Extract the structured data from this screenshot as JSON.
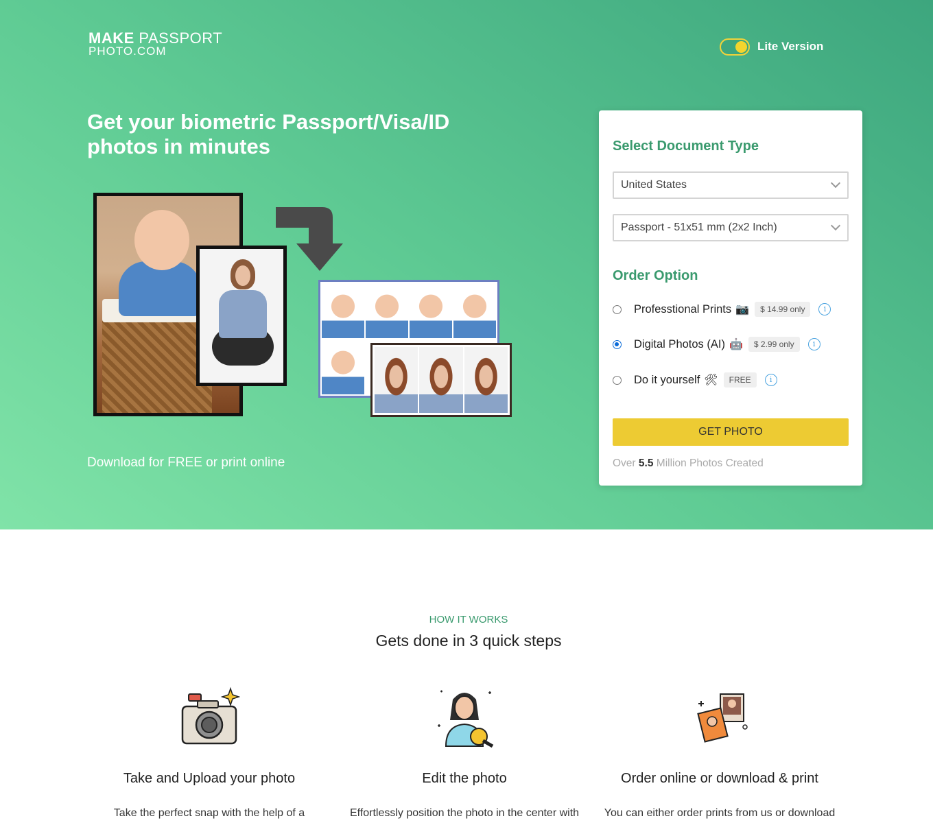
{
  "header": {
    "logo_line1_bold": "MAKE",
    "logo_line1_rest": "PASSPORT",
    "logo_line2": "PHOTO.COM",
    "lite_toggle_label": "Lite Version"
  },
  "hero": {
    "title": "Get your biometric Passport/Visa/ID photos in minutes",
    "subtitle": "Download for FREE or print online"
  },
  "card": {
    "doc_heading": "Select Document Type",
    "country_value": "United States",
    "document_value": "Passport - 51x51 mm (2x2 Inch)",
    "order_heading": "Order Option",
    "options": [
      {
        "label": "Professtional Prints",
        "emoji": "📷",
        "price": "$ 14.99 only",
        "selected": false
      },
      {
        "label": "Digital Photos (AI)",
        "emoji": "🤖",
        "price": "$ 2.99 only",
        "selected": true
      },
      {
        "label": "Do it yourself",
        "emoji": "🛠",
        "price": "FREE",
        "selected": false
      }
    ],
    "button_label": "GET PHOTO",
    "stat_prefix": "Over",
    "stat_value": "5.5",
    "stat_suffix": "Million Photos Created"
  },
  "how": {
    "kicker": "HOW IT WORKS",
    "title": "Gets done in 3 quick steps",
    "steps": [
      {
        "title": "Take and Upload your photo",
        "desc": "Take the perfect snap with the help of a",
        "icon": "camera-icon"
      },
      {
        "title": "Edit the photo",
        "desc": "Effortlessly position the photo in the center with",
        "icon": "edit-person-icon"
      },
      {
        "title": "Order online or download & print",
        "desc": "You can either order prints from us or download",
        "icon": "photos-icon"
      }
    ]
  },
  "colors": {
    "brand_green": "#3a9a6e",
    "button_yellow": "#edcb33",
    "hero_gradient_start": "#80e3a8",
    "hero_gradient_end": "#3da67e"
  }
}
